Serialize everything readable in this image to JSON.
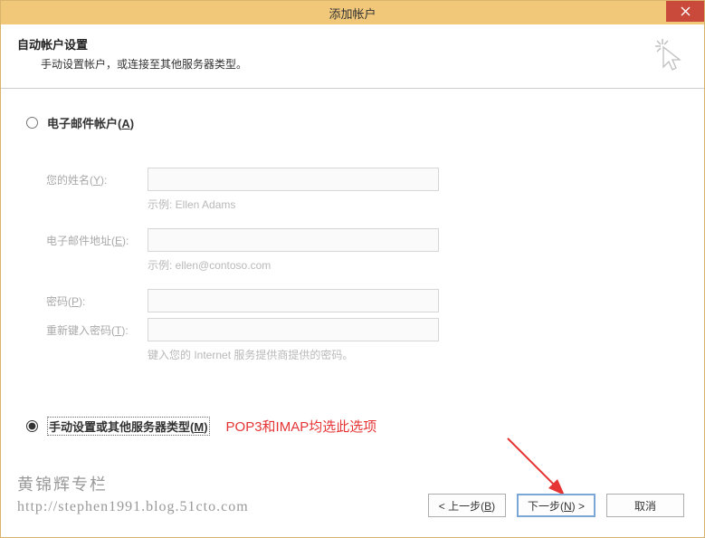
{
  "window": {
    "title": "添加帐户"
  },
  "header": {
    "title": "自动帐户设置",
    "subtitle": "手动设置帐户，或连接至其他服务器类型。"
  },
  "radios": {
    "email": {
      "label_pre": "电子邮件帐户(",
      "key": "A",
      "label_post": ")"
    },
    "manual": {
      "label_pre": "手动设置或其他服务器类型(",
      "key": "M",
      "label_post": ")"
    }
  },
  "fields": {
    "name": {
      "label_pre": "您的姓名(",
      "key": "Y",
      "label_post": "):",
      "value": "",
      "hint": "示例: Ellen Adams"
    },
    "email": {
      "label_pre": "电子邮件地址(",
      "key": "E",
      "label_post": "):",
      "value": "",
      "hint": "示例: ellen@contoso.com"
    },
    "password": {
      "label_pre": "密码(",
      "key": "P",
      "label_post": "):",
      "value": ""
    },
    "password2": {
      "label_pre": "重新键入密码(",
      "key": "T",
      "label_post": "):",
      "value": "",
      "hint": "键入您的 Internet 服务提供商提供的密码。"
    }
  },
  "annotation": "POP3和IMAP均选此选项",
  "buttons": {
    "back": {
      "pre": "< 上一步(",
      "key": "B",
      "post": ")"
    },
    "next": {
      "pre": "下一步(",
      "key": "N",
      "post": ") >"
    },
    "cancel": "取消"
  },
  "watermark": {
    "line1": "黄锦辉专栏",
    "line2": "http://stephen1991.blog.51cto.com"
  }
}
